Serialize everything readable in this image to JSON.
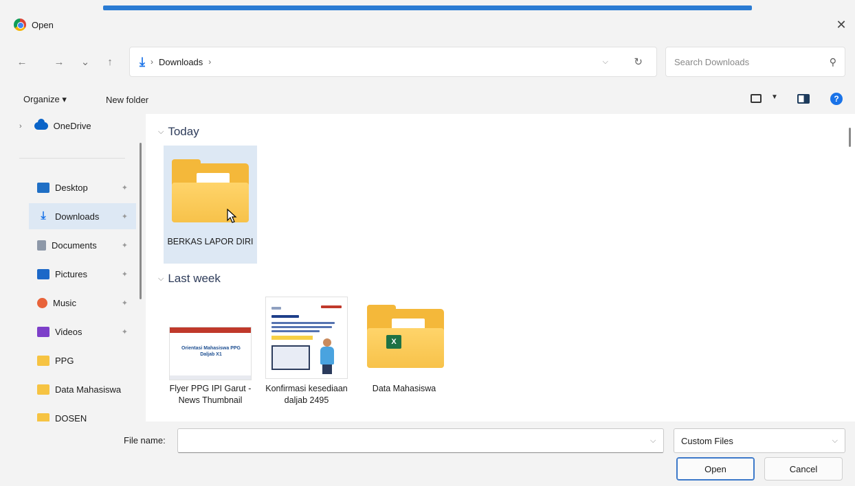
{
  "window": {
    "title": "Open",
    "close_glyph": "✕"
  },
  "nav": {
    "back": "←",
    "forward": "→",
    "recent": "⌄",
    "up": "↑",
    "breadcrumb": [
      "Downloads"
    ],
    "refresh": "↻",
    "search_placeholder": "Search Downloads"
  },
  "commands": {
    "organize": "Organize ▾",
    "new_folder": "New folder"
  },
  "sidebar": {
    "onedrive": "OneDrive",
    "items": [
      {
        "label": "Desktop",
        "icon": "desktop-icon"
      },
      {
        "label": "Downloads",
        "icon": "download-icon",
        "selected": true
      },
      {
        "label": "Documents",
        "icon": "document-icon"
      },
      {
        "label": "Pictures",
        "icon": "pictures-icon"
      },
      {
        "label": "Music",
        "icon": "music-icon"
      },
      {
        "label": "Videos",
        "icon": "videos-icon"
      },
      {
        "label": "PPG",
        "icon": "folder-icon"
      },
      {
        "label": "Data Mahasiswa",
        "icon": "folder-icon"
      },
      {
        "label": "DOSEN",
        "icon": "folder-icon"
      }
    ]
  },
  "groups": {
    "today": {
      "header": "Today",
      "files": [
        {
          "name": "BERKAS LAPOR DIRI",
          "type": "folder"
        }
      ]
    },
    "last_week": {
      "header": "Last week",
      "files": [
        {
          "name": "Flyer PPG IPI Garut - News Thumbnail",
          "type": "image",
          "thumb_text": "Orientasi Mahasiswa PPG Daljab X1"
        },
        {
          "name": "Konfirmasi kesediaan daljab 2495",
          "type": "image"
        },
        {
          "name": "Data Mahasiswa",
          "type": "folder"
        }
      ]
    }
  },
  "footer": {
    "file_name_label": "File name:",
    "file_name_value": "",
    "file_type": "Custom Files",
    "open_label": "Open",
    "cancel_label": "Cancel"
  },
  "colors": {
    "accent": "#2a7bd3",
    "selection": "#dde8f4",
    "folder": "#f4b83a"
  }
}
